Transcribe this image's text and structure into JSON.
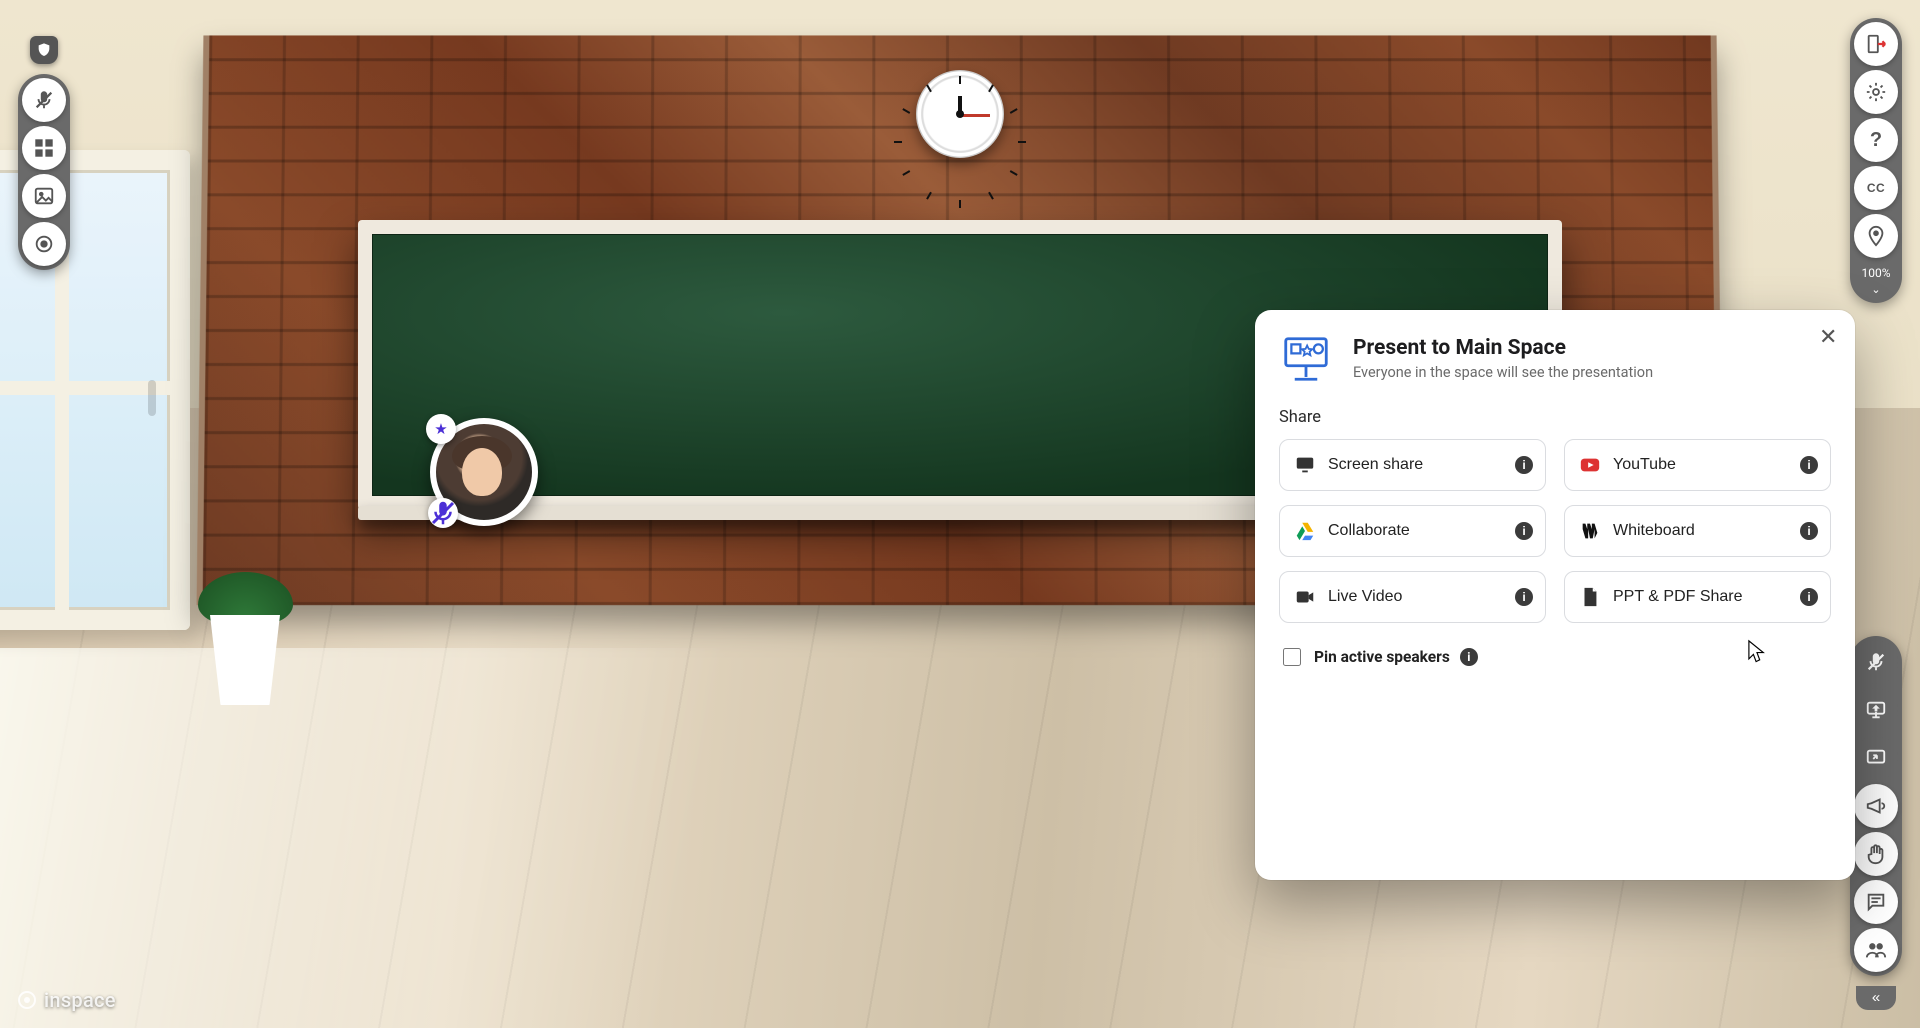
{
  "branding": {
    "text": "inspace"
  },
  "zoom": {
    "value": "100%"
  },
  "avatar": {
    "badge_star_icon": "star-icon",
    "badge_mic_icon": "mic-muted-icon"
  },
  "left_toolbar": {
    "shield": "shield-icon",
    "items": [
      {
        "name": "mic-muted-button",
        "icon": "mic-slash-icon"
      },
      {
        "name": "grid-view-button",
        "icon": "grid-icon"
      },
      {
        "name": "background-button",
        "icon": "image-icon"
      },
      {
        "name": "record-button",
        "icon": "record-icon"
      }
    ]
  },
  "right_top_toolbar": {
    "items": [
      {
        "name": "leave-button",
        "icon": "exit-icon"
      },
      {
        "name": "settings-button",
        "icon": "gear-icon"
      },
      {
        "name": "help-button",
        "icon": "help-icon",
        "text": "?"
      },
      {
        "name": "captions-button",
        "icon": "cc-icon",
        "text": "CC"
      },
      {
        "name": "location-button",
        "icon": "location-icon"
      }
    ]
  },
  "right_bottom_toolbar": {
    "items": [
      {
        "name": "mute-all-button",
        "icon": "mic-slash-icon"
      },
      {
        "name": "present-button",
        "icon": "screen-share-icon"
      },
      {
        "name": "share-to-board-button",
        "icon": "board-arrow-icon"
      },
      {
        "name": "announce-button",
        "icon": "megaphone-icon"
      },
      {
        "name": "raise-hand-button",
        "icon": "hand-icon"
      },
      {
        "name": "chat-button",
        "icon": "chat-icon"
      },
      {
        "name": "participants-button",
        "icon": "people-icon"
      }
    ]
  },
  "dialog": {
    "title": "Present to Main Space",
    "subtitle": "Everyone in the space will see the presentation",
    "share_label": "Share",
    "pin_label": "Pin active speakers",
    "options": [
      {
        "name": "screen-share-option",
        "label": "Screen share",
        "icon": "monitor-icon"
      },
      {
        "name": "youtube-option",
        "label": "YouTube",
        "icon": "youtube-icon"
      },
      {
        "name": "collaborate-option",
        "label": "Collaborate",
        "icon": "drive-icon"
      },
      {
        "name": "whiteboard-option",
        "label": "Whiteboard",
        "icon": "miro-icon"
      },
      {
        "name": "live-video-option",
        "label": "Live Video",
        "icon": "video-icon"
      },
      {
        "name": "ppt-pdf-option",
        "label": "PPT & PDF Share",
        "icon": "file-icon"
      }
    ]
  }
}
